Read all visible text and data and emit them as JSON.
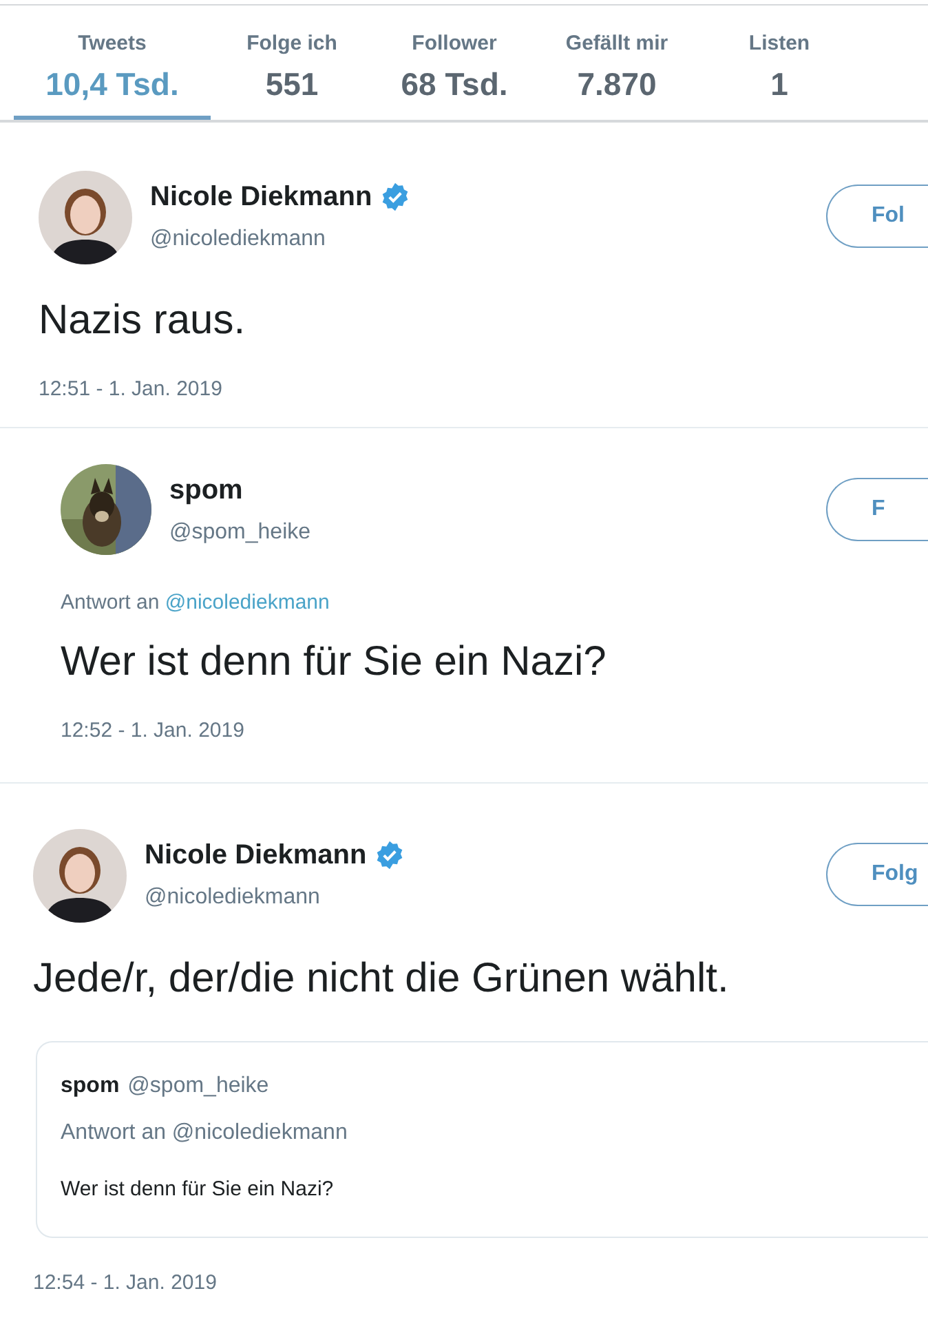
{
  "stats": [
    {
      "label": "Tweets",
      "value": "10,4 Tsd.",
      "selected": true
    },
    {
      "label": "Folge ich",
      "value": "551",
      "selected": false
    },
    {
      "label": "Follower",
      "value": "68 Tsd.",
      "selected": false
    },
    {
      "label": "Gefällt mir",
      "value": "7.870",
      "selected": false
    },
    {
      "label": "Listen",
      "value": "1",
      "selected": false
    }
  ],
  "tweets": [
    {
      "avatar": {
        "kind": "person"
      },
      "indented": false,
      "name": "Nicole Diekmann",
      "verified": true,
      "handle": "@nicolediekmann",
      "follow_label": "Fol",
      "text": "Nazis raus.",
      "time": "12:51 - 1. Jan. 2019"
    },
    {
      "indented": true,
      "name": "spom",
      "verified": false,
      "handle": "@spom_heike",
      "follow_label": "F",
      "reply_prefix": "Antwort an",
      "reply_handle": "@nicolediekmann",
      "text": "Wer ist denn für Sie ein Nazi?",
      "time": "12:52 - 1. Jan. 2019"
    },
    {
      "avatar": {
        "kind": "person"
      },
      "indented": false,
      "name": "Nicole Diekmann",
      "verified": true,
      "handle": "@nicolediekmann",
      "follow_label": "Folg",
      "text": "Jede/r, der/die nicht die Grünen wählt.",
      "quote": {
        "name": "spom",
        "handle": "@spom_heike",
        "reply": "Antwort an @nicolediekmann",
        "text": "Wer ist denn für Sie ein Nazi?"
      },
      "time": "12:54 - 1. Jan. 2019"
    }
  ]
}
